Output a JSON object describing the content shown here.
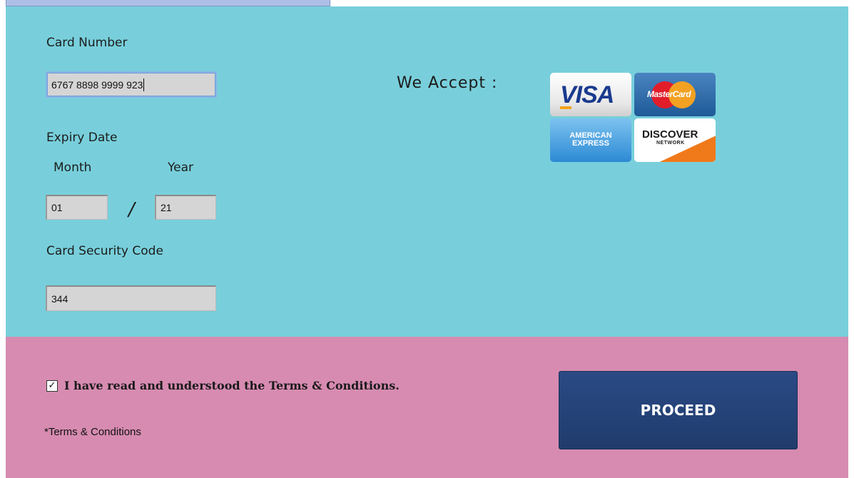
{
  "card_form": {
    "card_number_label": "Card Number",
    "card_number_value": "6767 8898 9999 923",
    "expiry_label": "Expiry Date",
    "month_label": "Month",
    "year_label": "Year",
    "month_value": "01",
    "separator": "/",
    "year_value": "21",
    "security_code_label": "Card Security Code",
    "security_code_value": "344"
  },
  "accepted_cards": {
    "heading": "We Accept :",
    "logos": [
      {
        "name": "visa",
        "text": "VISA"
      },
      {
        "name": "mastercard",
        "text": "MasterCard"
      },
      {
        "name": "american-express",
        "text_line1": "AMERICAN",
        "text_line2": "EXPRESS"
      },
      {
        "name": "discover",
        "text": "DISCOVER",
        "subtext": "NETWORK"
      }
    ]
  },
  "terms": {
    "checkbox_checked": true,
    "checkbox_label": "I have read and understood the Terms & Conditions.",
    "link_text": "*Terms & Conditions"
  },
  "actions": {
    "proceed_label": "PROCEED"
  },
  "colors": {
    "card_panel_bg": "#78cfdb",
    "terms_panel_bg": "#d78bb1",
    "proceed_bg": "#243f74"
  }
}
